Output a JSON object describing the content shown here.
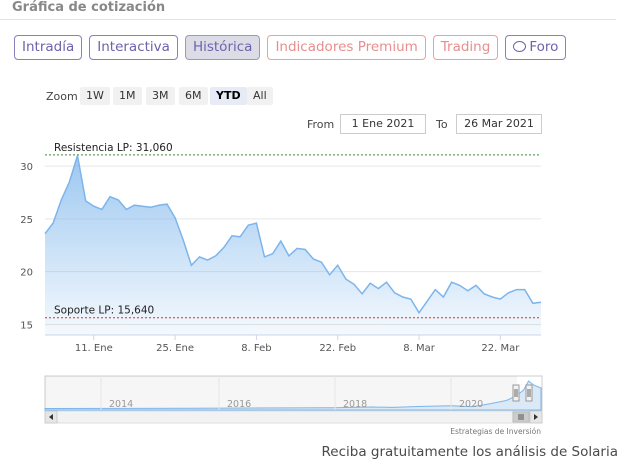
{
  "header": {
    "title": "Gráfica de cotización"
  },
  "tabs": [
    {
      "label": "Intradía",
      "state": "normal"
    },
    {
      "label": "Interactiva",
      "state": "normal"
    },
    {
      "label": "Histórica",
      "state": "active"
    },
    {
      "label": "Indicadores Premium",
      "state": "premium"
    },
    {
      "label": "Trading",
      "state": "premium"
    },
    {
      "label": "Foro",
      "state": "normal",
      "icon": "chat-bubble-icon"
    }
  ],
  "zoom": {
    "label": "Zoom",
    "buttons": [
      "1W",
      "1M",
      "3M",
      "6M",
      "YTD",
      "All"
    ],
    "selected": "YTD"
  },
  "range": {
    "from_label": "From",
    "from_value": "1 Ene 2021",
    "to_label": "To",
    "to_value": "26 Mar 2021"
  },
  "colors": {
    "line": "#7cb5ec",
    "resistance": "#3b8a3b",
    "support": "#cc3333",
    "accent": "#6f62ad",
    "premium": "#e88e8e"
  },
  "chart_data": {
    "type": "area",
    "ylim": [
      14,
      32
    ],
    "yticks": [
      15,
      20,
      25,
      30
    ],
    "x_ticks": [
      "11. Ene",
      "25. Ene",
      "8. Feb",
      "22. Feb",
      "8. Mar",
      "22. Mar"
    ],
    "annotations": [
      {
        "label": "Resistencia LP: 31,060",
        "value": 31.06
      },
      {
        "label": "Soporte LP: 15,640",
        "value": 15.64
      }
    ],
    "series": [
      {
        "values": [
          23.6,
          24.6,
          26.8,
          28.5,
          31.0,
          26.7,
          26.2,
          25.9,
          27.1,
          26.8,
          25.9,
          26.3,
          26.2,
          26.1,
          26.3,
          26.4,
          25.1,
          23.0,
          20.6,
          21.4,
          21.1,
          21.5,
          22.3,
          23.4,
          23.3,
          24.4,
          24.6,
          21.4,
          21.7,
          22.9,
          21.5,
          22.2,
          22.1,
          21.2,
          20.9,
          19.7,
          20.6,
          19.3,
          18.8,
          17.9,
          18.9,
          18.4,
          19.0,
          18.0,
          17.6,
          17.4,
          16.1,
          17.2,
          18.3,
          17.6,
          19.0,
          18.7,
          18.2,
          18.7,
          17.9,
          17.6,
          17.4,
          18.0,
          18.3,
          18.3,
          17.0,
          17.1
        ]
      }
    ]
  },
  "navigator": {
    "year_labels": [
      "2014",
      "2016",
      "2018",
      "2020"
    ]
  },
  "credits": "Estrategias de Inversión",
  "cta": "Reciba gratuitamente los análisis de Solaria"
}
